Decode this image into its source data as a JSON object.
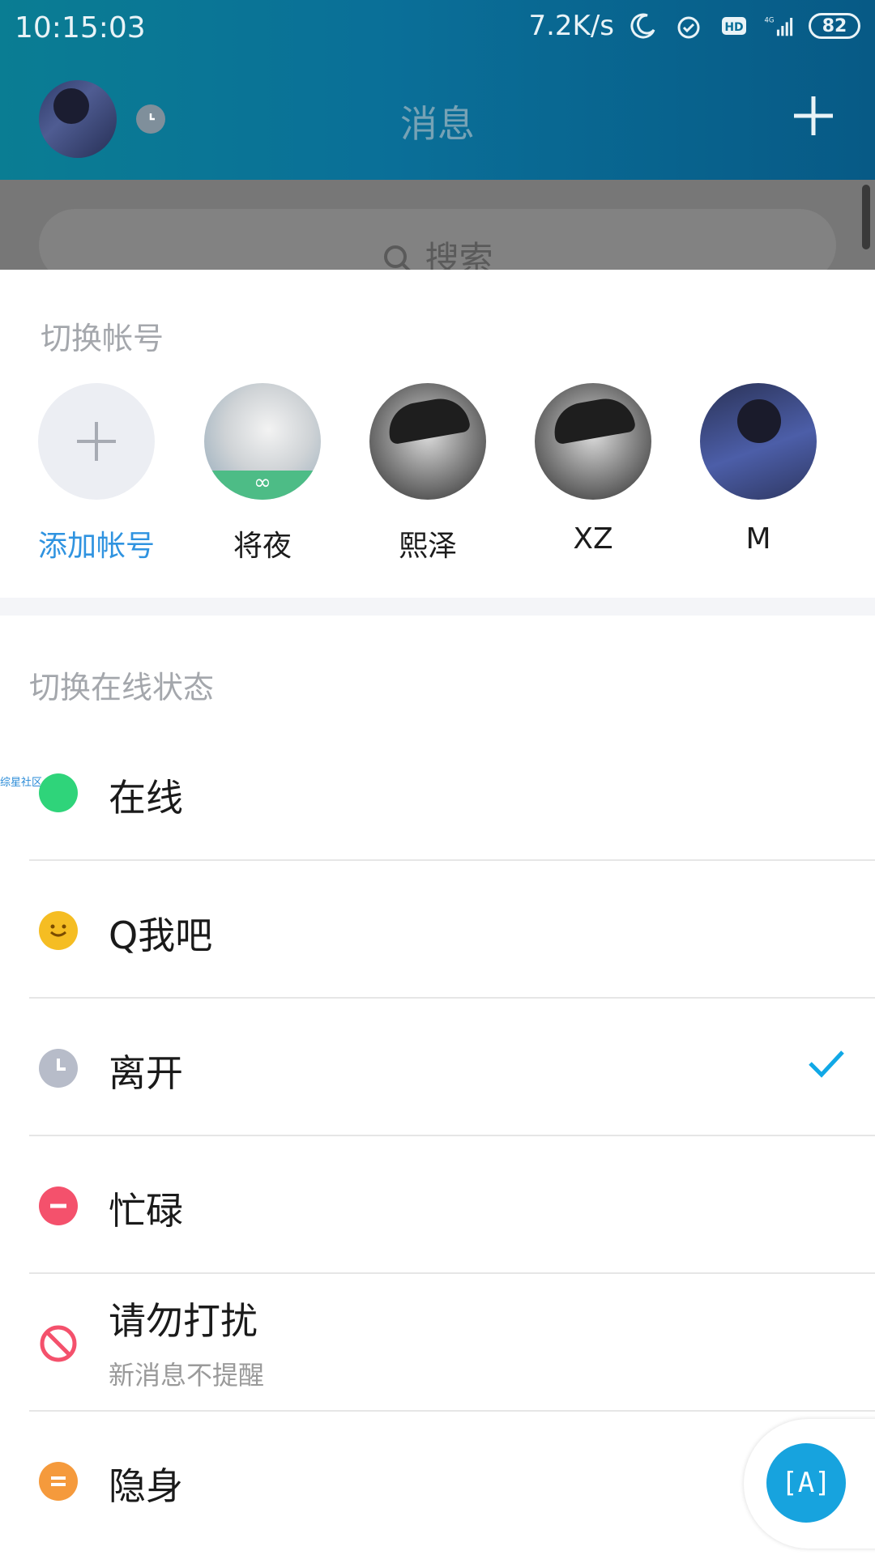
{
  "status_bar": {
    "time": "10:15:03",
    "net_speed": "7.2K/s",
    "network": "4G",
    "battery": "82",
    "icons": [
      "moon-icon",
      "alarm-icon",
      "hd-icon",
      "signal-icon",
      "battery-icon"
    ]
  },
  "header": {
    "title": "消息",
    "search_placeholder": "搜索"
  },
  "switch_account": {
    "section_title": "切换帐号",
    "accounts": [
      {
        "label": "添加帐号",
        "type": "add"
      },
      {
        "label": "将夜",
        "type": "avatar"
      },
      {
        "label": "熙泽",
        "type": "avatar"
      },
      {
        "label": "XZ",
        "type": "avatar"
      },
      {
        "label": "M",
        "type": "avatar"
      }
    ]
  },
  "online_status": {
    "section_title": "切换在线状态",
    "tiny_label": "综星社区",
    "items": [
      {
        "label": "在线",
        "color": "#2fd47a",
        "icon": "online-dot-icon",
        "selected": false
      },
      {
        "label": "Q我吧",
        "color": "#f5bd23",
        "icon": "smile-icon",
        "selected": false
      },
      {
        "label": "离开",
        "color": "#b7bcc9",
        "icon": "clock-icon",
        "selected": true
      },
      {
        "label": "忙碌",
        "color": "#f4516c",
        "icon": "minus-icon",
        "selected": false
      },
      {
        "label": "请勿打扰",
        "sublabel": "新消息不提醒",
        "color": "#f4516c",
        "icon": "no-entry-icon",
        "selected": false
      },
      {
        "label": "隐身",
        "color": "#f59a3c",
        "icon": "equals-icon",
        "selected": false
      }
    ]
  },
  "floating": {
    "label": "[A]"
  },
  "colors": {
    "accent_blue": "#2f93e0",
    "check": "#11a8e6"
  }
}
